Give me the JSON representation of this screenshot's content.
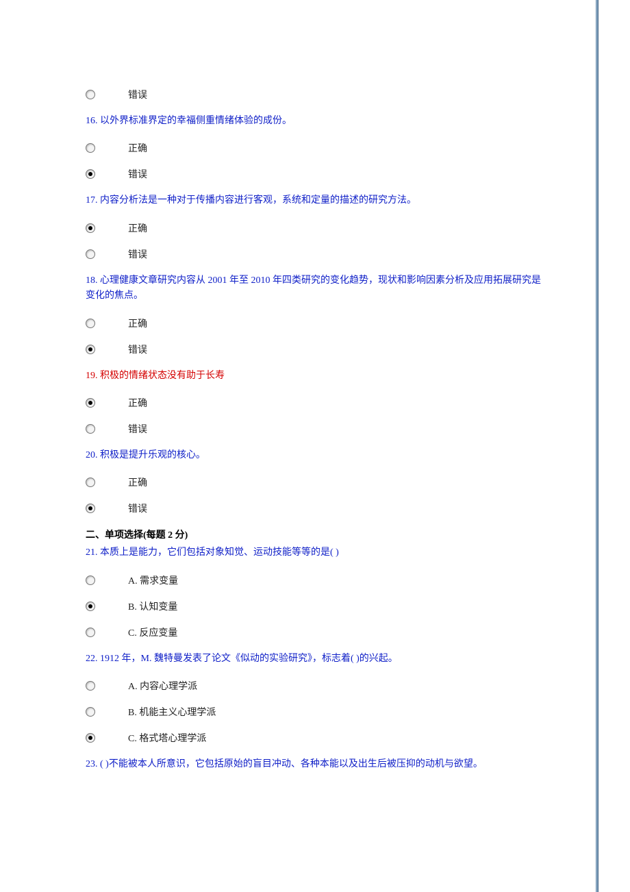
{
  "questions": [
    {
      "number": "",
      "text": "",
      "style": "none",
      "options": [
        {
          "label": "错误",
          "selected": false
        }
      ]
    },
    {
      "number": "16.",
      "text": "以外界标准界定的幸福侧重情绪体验的成份。",
      "style": "blue",
      "options": [
        {
          "label": "正确",
          "selected": false
        },
        {
          "label": "错误",
          "selected": true
        }
      ]
    },
    {
      "number": "17.",
      "text": "内容分析法是一种对于传播内容进行客观，系统和定量的描述的研究方法。",
      "style": "blue",
      "options": [
        {
          "label": "正确",
          "selected": true
        },
        {
          "label": "错误",
          "selected": false
        }
      ]
    },
    {
      "number": "18.",
      "text": "心理健康文章研究内容从 2001 年至 2010 年四类研究的变化趋势，现状和影响因素分析及应用拓展研究是变化的焦点。",
      "style": "blue",
      "options": [
        {
          "label": "正确",
          "selected": false
        },
        {
          "label": "错误",
          "selected": true
        }
      ]
    },
    {
      "number": "19.",
      "text": "积极的情绪状态没有助于长寿",
      "style": "red",
      "options": [
        {
          "label": "正确",
          "selected": true
        },
        {
          "label": "错误",
          "selected": false
        }
      ]
    },
    {
      "number": "20.",
      "text": "积极是提升乐观的核心。",
      "style": "blue",
      "options": [
        {
          "label": "正确",
          "selected": false
        },
        {
          "label": "错误",
          "selected": true
        }
      ]
    }
  ],
  "section2": {
    "title": "二、单项选择(每题 2 分)",
    "questions": [
      {
        "number": "21.",
        "text": "本质上是能力，它们包括对象知觉、运动技能等等的是( )",
        "style": "blue",
        "options": [
          {
            "label": "A. 需求变量",
            "selected": false
          },
          {
            "label": "B. 认知变量",
            "selected": true
          },
          {
            "label": "C. 反应变量",
            "selected": false
          }
        ]
      },
      {
        "number": "22.",
        "text": "1912 年，M. 魏特曼发表了论文《似动的实验研究》，标志着( )的兴起。",
        "style": "blue",
        "options": [
          {
            "label": "A.  内容心理学派",
            "selected": false
          },
          {
            "label": "B.  机能主义心理学派",
            "selected": false
          },
          {
            "label": "C.  格式塔心理学派",
            "selected": true
          }
        ]
      },
      {
        "number": "23.",
        "text": "( )不能被本人所意识，它包括原始的盲目冲动、各种本能以及出生后被压抑的动机与欲望。",
        "style": "blue",
        "options": []
      }
    ]
  }
}
